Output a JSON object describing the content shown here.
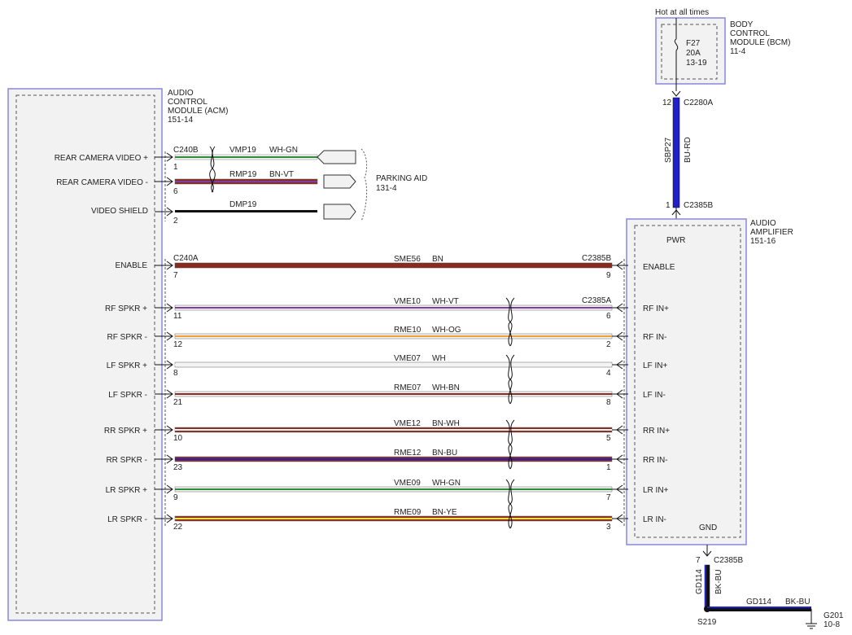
{
  "acm": {
    "title_lines": [
      "AUDIO",
      "CONTROL",
      "MODULE (ACM)",
      "151-14"
    ]
  },
  "bcm": {
    "hot_label": "Hot at all times",
    "title_lines": [
      "BODY",
      "CONTROL",
      "MODULE (BCM)",
      "11-4"
    ],
    "fuse_lines": [
      "F27",
      "20A",
      "13-19"
    ]
  },
  "amp": {
    "title_lines": [
      "AUDIO",
      "AMPLIFIER",
      "151-16"
    ],
    "pwr_label": "PWR",
    "gnd_label": "GND"
  },
  "parking_aid": {
    "lines": [
      "PARKING AID",
      "131-4"
    ]
  },
  "connectors": {
    "c240b": "C240B",
    "c240a": "C240A",
    "c2385b": "C2385B",
    "c2385a": "C2385A",
    "c2280a": "C2280A",
    "c2385b_pwr": "C2385B",
    "c2385b_gnd": "C2385B"
  },
  "video": [
    {
      "label": "REAR CAMERA VIDEO +",
      "pin": "1",
      "circuit": "VMP19",
      "color": "WH-GN"
    },
    {
      "label": "REAR CAMERA VIDEO -",
      "pin": "6",
      "circuit": "RMP19",
      "color": "BN-VT"
    },
    {
      "label": "VIDEO SHIELD",
      "pin": "2",
      "circuit": "DMP19",
      "color": ""
    }
  ],
  "enable": {
    "label": "ENABLE",
    "pin_left": "7",
    "circuit": "SME56",
    "color": "BN",
    "pin_right": "9",
    "amp_label": "ENABLE"
  },
  "speakers": [
    {
      "label": "RF SPKR +",
      "pin_left": "11",
      "circuit": "VME10",
      "color": "WH-VT",
      "pin_right": "6",
      "amp_label": "RF IN+"
    },
    {
      "label": "RF SPKR -",
      "pin_left": "12",
      "circuit": "RME10",
      "color": "WH-OG",
      "pin_right": "2",
      "amp_label": "RF IN-"
    },
    {
      "label": "LF SPKR +",
      "pin_left": "8",
      "circuit": "VME07",
      "color": "WH",
      "pin_right": "4",
      "amp_label": "LF IN+"
    },
    {
      "label": "LF SPKR -",
      "pin_left": "21",
      "circuit": "RME07",
      "color": "WH-BN",
      "pin_right": "8",
      "amp_label": "LF IN-"
    },
    {
      "label": "RR SPKR +",
      "pin_left": "10",
      "circuit": "VME12",
      "color": "BN-WH",
      "pin_right": "5",
      "amp_label": "RR IN+"
    },
    {
      "label": "RR SPKR -",
      "pin_left": "23",
      "circuit": "RME12",
      "color": "BN-BU",
      "pin_right": "1",
      "amp_label": "RR IN-"
    },
    {
      "label": "LR SPKR +",
      "pin_left": "9",
      "circuit": "VME09",
      "color": "WH-GN",
      "pin_right": "7",
      "amp_label": "LR IN+"
    },
    {
      "label": "LR SPKR -",
      "pin_left": "22",
      "circuit": "RME09",
      "color": "BN-YE",
      "pin_right": "3",
      "amp_label": "LR IN-"
    }
  ],
  "power_wire": {
    "pin_top": "12",
    "pin_bottom": "1",
    "circuit": "SBP27",
    "color": "BU-RD"
  },
  "ground_wire": {
    "pin_top": "7",
    "circuit": "GD114",
    "color": "BK-BU",
    "splice": "S219",
    "h_circuit": "GD114",
    "h_color": "BK-BU",
    "ground_id": "G201",
    "ground_ref": "10-8"
  },
  "wire_colors": {
    "white": "#f4f4f4",
    "green": "#2e8b3a",
    "brown": "#8b2a1e",
    "violet": "#7b3fa0",
    "orange": "#f0a030",
    "blue": "#2020c8",
    "yellow": "#f5e23a",
    "black": "#111111",
    "red": "#d01010",
    "module_border": "#8888dd"
  }
}
